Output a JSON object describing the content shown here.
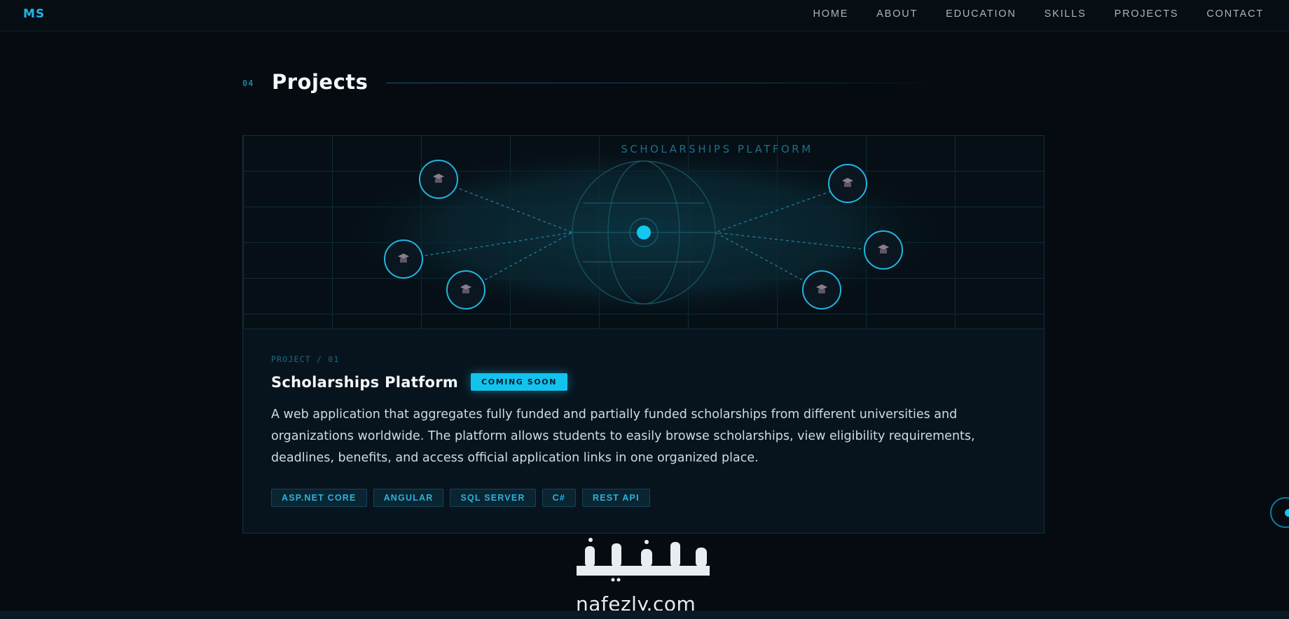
{
  "header": {
    "logo": "MS",
    "nav": [
      "HOME",
      "ABOUT",
      "EDUCATION",
      "SKILLS",
      "PROJECTS",
      "CONTACT"
    ]
  },
  "section": {
    "number": "04",
    "title": "Projects"
  },
  "project": {
    "banner_title": "SCHOLARSHIPS PLATFORM",
    "label": "PROJECT / 01",
    "title": "Scholarships Platform",
    "badge": "COMING SOON",
    "description": "A web application that aggregates fully funded and partially funded scholarships from different universities and organizations worldwide. The platform allows students to easily browse scholarships, view eligibility requirements, deadlines, benefits, and access official application links in one organized place.",
    "tags": [
      "ASP.NET CORE",
      "ANGULAR",
      "SQL SERVER",
      "C#",
      "REST API"
    ],
    "node_icon": "graduation-cap-icon"
  },
  "watermark": {
    "arabic": "نفذلي",
    "latin": "nafezly.com"
  },
  "colors": {
    "accent": "#12c3ee",
    "background": "#050b11",
    "card": "#08141d"
  }
}
